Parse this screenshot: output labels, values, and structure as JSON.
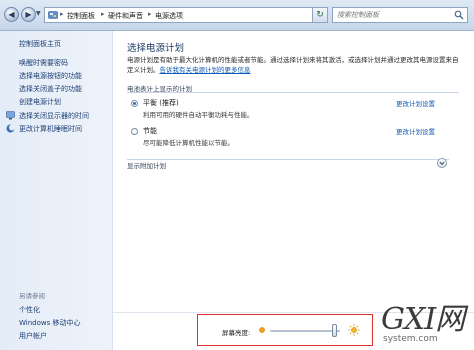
{
  "address_bar": {
    "breadcrumbs": [
      "控制面板",
      "硬件和声音",
      "电源选项"
    ],
    "search_placeholder": "搜索控制面板"
  },
  "sidebar": {
    "home_link": "控制面板主页",
    "items": [
      {
        "label": "唤醒时需要密码",
        "icon": "none"
      },
      {
        "label": "选择电源按钮的功能",
        "icon": "none"
      },
      {
        "label": "选择关闭盖子的功能",
        "icon": "none"
      },
      {
        "label": "创建电源计划",
        "icon": "none"
      },
      {
        "label": "选择关闭显示器的时间",
        "icon": "monitor-icon"
      },
      {
        "label": "更改计算机睡眠时间",
        "icon": "moon-icon"
      }
    ],
    "see_also": {
      "heading": "另请参阅",
      "items": [
        "个性化",
        "Windows 移动中心",
        "用户帐户"
      ]
    }
  },
  "main": {
    "title": "选择电源计划",
    "description": "电源计划是有助于最大化计算机的性能或者节能。通过选择计划来将其激活，或选择计划并通过更改其电源设置来自定义计划。",
    "description_link": "告诉我有关电源计划的更多信息",
    "section_heading": "电池表计上显示的计划",
    "plans": [
      {
        "name": "平衡 (推荐)",
        "description": "利用可用的硬件自动平衡功耗与性能。",
        "selected": true,
        "link": "更改计划设置"
      },
      {
        "name": "节能",
        "description": "尽可能降低计算机性能以节能。",
        "selected": false,
        "link": "更改计划设置"
      }
    ],
    "extra_plans": "显示附加计划"
  },
  "brightness": {
    "label": "屏幕亮度:",
    "level_fraction": 0.95
  },
  "watermark": {
    "big": "GXI网",
    "small": "system.com"
  },
  "colors": {
    "link": "#0e5bb5",
    "highlight_border": "#e03030",
    "watermark_accent": "#d23a2a"
  }
}
